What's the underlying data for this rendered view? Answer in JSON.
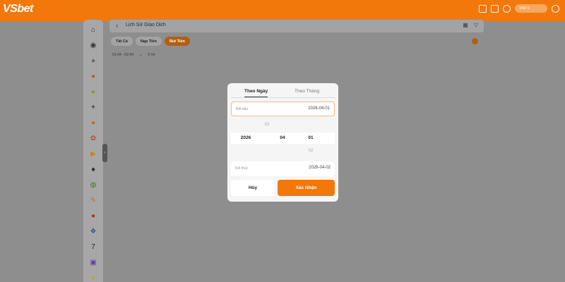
{
  "app": {
    "logo": "VSbet",
    "currency": "VND 0"
  },
  "topbar": {
    "icons": [
      "deposit-icon",
      "gift-icon",
      "headset-icon",
      "user-icon"
    ]
  },
  "sidebar": {
    "items": [
      {
        "icon": "home-icon",
        "glyph": "⌂",
        "color": "#333333"
      },
      {
        "icon": "sports-icon",
        "glyph": "◉",
        "color": "#333333"
      },
      {
        "icon": "soccer-icon",
        "glyph": "●",
        "color": "#666666"
      },
      {
        "icon": "basketball-icon",
        "glyph": "●",
        "color": "#c4581a"
      },
      {
        "icon": "tennis-icon",
        "glyph": "●",
        "color": "#7fa020"
      },
      {
        "icon": "esports-icon",
        "glyph": "✦",
        "color": "#555555"
      },
      {
        "icon": "volleyball-icon",
        "glyph": "●",
        "color": "#c46a1a"
      },
      {
        "icon": "lottery-icon",
        "glyph": "✿",
        "color": "#b05030"
      },
      {
        "icon": "video-icon",
        "glyph": "▶",
        "color": "#d08010"
      },
      {
        "icon": "cards-icon",
        "glyph": "♠",
        "color": "#222222"
      },
      {
        "icon": "casino-chip-icon",
        "glyph": "◍",
        "color": "#3a7a2a"
      },
      {
        "icon": "cockfight-icon",
        "glyph": "✎",
        "color": "#c07020"
      },
      {
        "icon": "fishing-icon",
        "glyph": "●",
        "color": "#b03020"
      },
      {
        "icon": "slots-icon",
        "glyph": "❖",
        "color": "#3050a0"
      },
      {
        "icon": "seven-icon",
        "glyph": "7",
        "color": "#222222"
      },
      {
        "icon": "dice-icon",
        "glyph": "▣",
        "color": "#6040a0"
      },
      {
        "icon": "coin-icon",
        "glyph": "●",
        "color": "#d0a020"
      }
    ]
  },
  "header": {
    "title": "Lịch Sử Giao Dịch"
  },
  "tabs": [
    {
      "label": "Tất Cả",
      "active": false
    },
    {
      "label": "Nạp Tiền",
      "active": false
    },
    {
      "label": "Rút Tiền",
      "active": true
    }
  ],
  "filter": {
    "date_range": "01-04 - 02-04",
    "status": "0 Vé"
  },
  "modal": {
    "tab_day": "Theo Ngày",
    "tab_month": "Theo Tháng",
    "start_label": "Bắt đầu",
    "start_value": "2026-04-01",
    "end_label": "Kết thúc",
    "end_value": "2026-04-02",
    "picker_above": {
      "year": "",
      "month": "",
      "day": "03"
    },
    "picker_selected": {
      "year": "2026",
      "month": "04",
      "day": "01"
    },
    "picker_below": {
      "year": "",
      "month": "",
      "day": "02"
    },
    "cancel_label": "Hủy",
    "confirm_label": "Xác Nhận"
  },
  "colors": {
    "brand": "#f2780c",
    "overlay": "#8e8e8e"
  }
}
